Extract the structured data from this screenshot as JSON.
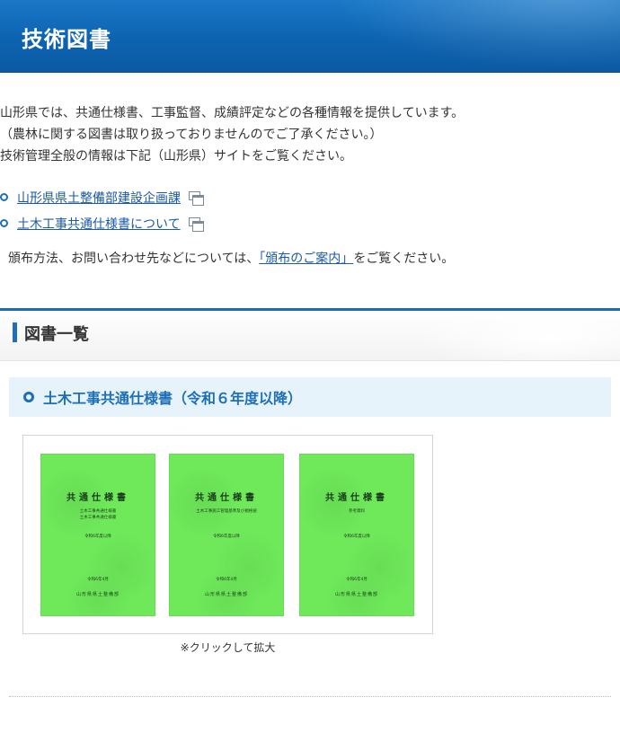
{
  "header": {
    "title": "技術図書"
  },
  "intro": {
    "line1": "山形県では、共通仕様書、工事監督、成績評定などの各種情報を提供しています。",
    "line2": "（農林に関する図書は取り扱っておりませんのでご了承ください。）",
    "line3": "技術管理全般の情報は下記（山形県）サイトをご覧ください。"
  },
  "links": [
    {
      "label": "山形県県土整備部建設企画課",
      "icon": "new-window-icon"
    },
    {
      "label": "土木工事共通仕様書について",
      "icon": "new-window-icon"
    }
  ],
  "distribution": {
    "before": "頒布方法、お問い合わせ先などについては、",
    "link": "「頒布のご案内」",
    "after": "をご覧ください。"
  },
  "section": {
    "title": "図書一覧"
  },
  "subsection": {
    "title": "土木工事共通仕様書（令和６年度以降）"
  },
  "covers": [
    {
      "title": "共通仕様書",
      "line1": "土木工事共通仕様書",
      "line2": "土木工事共通仕様書",
      "line3": "令和6年度以降",
      "line4": "令和6年4月",
      "publisher": "山形県県土整備部"
    },
    {
      "title": "共通仕様書",
      "line1": "土木工事施工管理基準及び規格値",
      "line2": "",
      "line3": "令和6年度以降",
      "line4": "令和6年4月",
      "publisher": "山形県県土整備部"
    },
    {
      "title": "共通仕様書",
      "line1": "参考資料",
      "line2": "",
      "line3": "令和6年度以降",
      "line4": "令和6年4月",
      "publisher": "山形県県土整備部"
    }
  ],
  "gallery": {
    "caption": "※クリックして拡大"
  },
  "colors": {
    "header_blue": "#0d63b0",
    "link_blue": "#1a5aa8",
    "accent_blue": "#1e6fb5",
    "subhead_bg": "#e6f3fb",
    "cover_green": "#6fe85a"
  }
}
